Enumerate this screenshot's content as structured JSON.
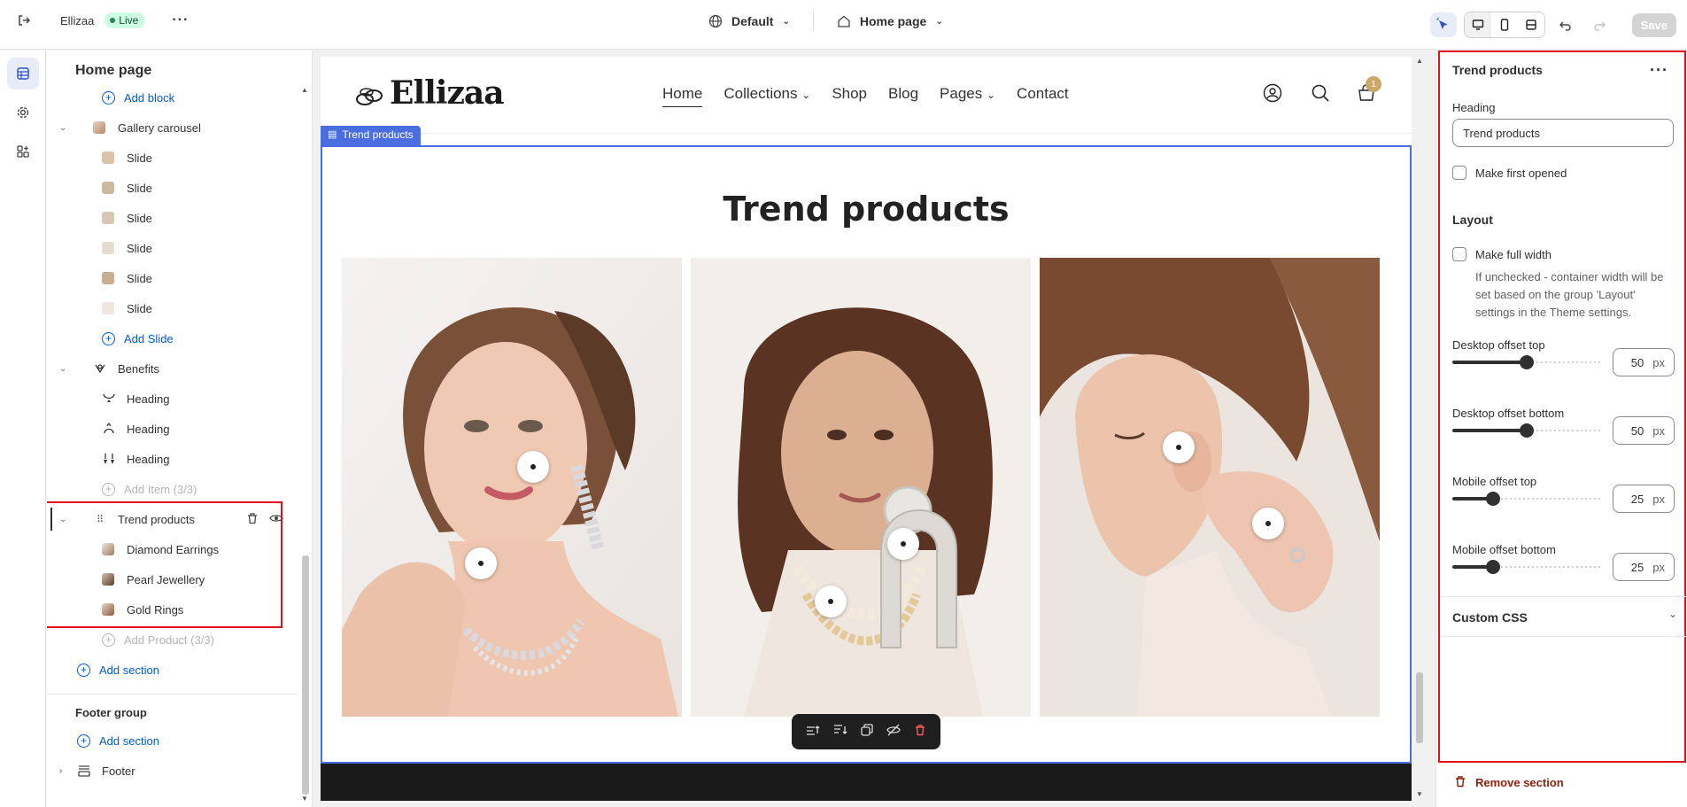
{
  "topbar": {
    "store_name": "Ellizaa",
    "status_badge": "Live",
    "theme_label": "Default",
    "page_label": "Home page",
    "save_label": "Save"
  },
  "sidebar": {
    "title": "Home page",
    "items": [
      {
        "label": "Add block",
        "kind": "add"
      },
      {
        "label": "Gallery carousel",
        "kind": "section"
      },
      {
        "label": "Slide",
        "kind": "block"
      },
      {
        "label": "Slide",
        "kind": "block"
      },
      {
        "label": "Slide",
        "kind": "block"
      },
      {
        "label": "Slide",
        "kind": "block"
      },
      {
        "label": "Slide",
        "kind": "block"
      },
      {
        "label": "Slide",
        "kind": "block"
      },
      {
        "label": "Add Slide",
        "kind": "add"
      },
      {
        "label": "Benefits",
        "kind": "section"
      },
      {
        "label": "Heading",
        "kind": "block"
      },
      {
        "label": "Heading",
        "kind": "block"
      },
      {
        "label": "Heading",
        "kind": "block"
      },
      {
        "label": "Add Item (3/3)",
        "kind": "add-disabled"
      },
      {
        "label": "Trend products",
        "kind": "section-selected"
      },
      {
        "label": "Diamond Earrings",
        "kind": "block"
      },
      {
        "label": "Pearl Jewellery",
        "kind": "block"
      },
      {
        "label": "Gold Rings",
        "kind": "block"
      },
      {
        "label": "Add Product (3/3)",
        "kind": "add-disabled"
      }
    ],
    "add_section": "Add section",
    "footer_group": "Footer group",
    "footer_add_section": "Add section",
    "footer_item": "Footer"
  },
  "preview": {
    "logo": "Ellizaa",
    "nav": [
      "Home",
      "Collections",
      "Shop",
      "Blog",
      "Pages",
      "Contact"
    ],
    "cart_count": "1",
    "section_tag": "Trend products",
    "section_title": "Trend products"
  },
  "inspector": {
    "title": "Trend products",
    "heading_label": "Heading",
    "heading_value": "Trend products",
    "make_first_opened": "Make first opened",
    "layout_title": "Layout",
    "make_full_width": "Make full width",
    "full_width_help": "If unchecked - container width will be set based on the group 'Layout' settings in the Theme settings.",
    "sliders": [
      {
        "label": "Desktop offset top",
        "value": "50",
        "unit": "px",
        "fraction": 0.5
      },
      {
        "label": "Desktop offset bottom",
        "value": "50",
        "unit": "px",
        "fraction": 0.5
      },
      {
        "label": "Mobile offset top",
        "value": "25",
        "unit": "px",
        "fraction": 0.25
      },
      {
        "label": "Mobile offset bottom",
        "value": "25",
        "unit": "px",
        "fraction": 0.25
      }
    ],
    "custom_css": "Custom CSS",
    "remove_section": "Remove section"
  },
  "colors": {
    "accent": "#4a6ee0",
    "link": "#005bd3",
    "highlight": "#e30f1f",
    "live_badge": "#cdfee1",
    "danger_text": "#8e1f0b"
  }
}
